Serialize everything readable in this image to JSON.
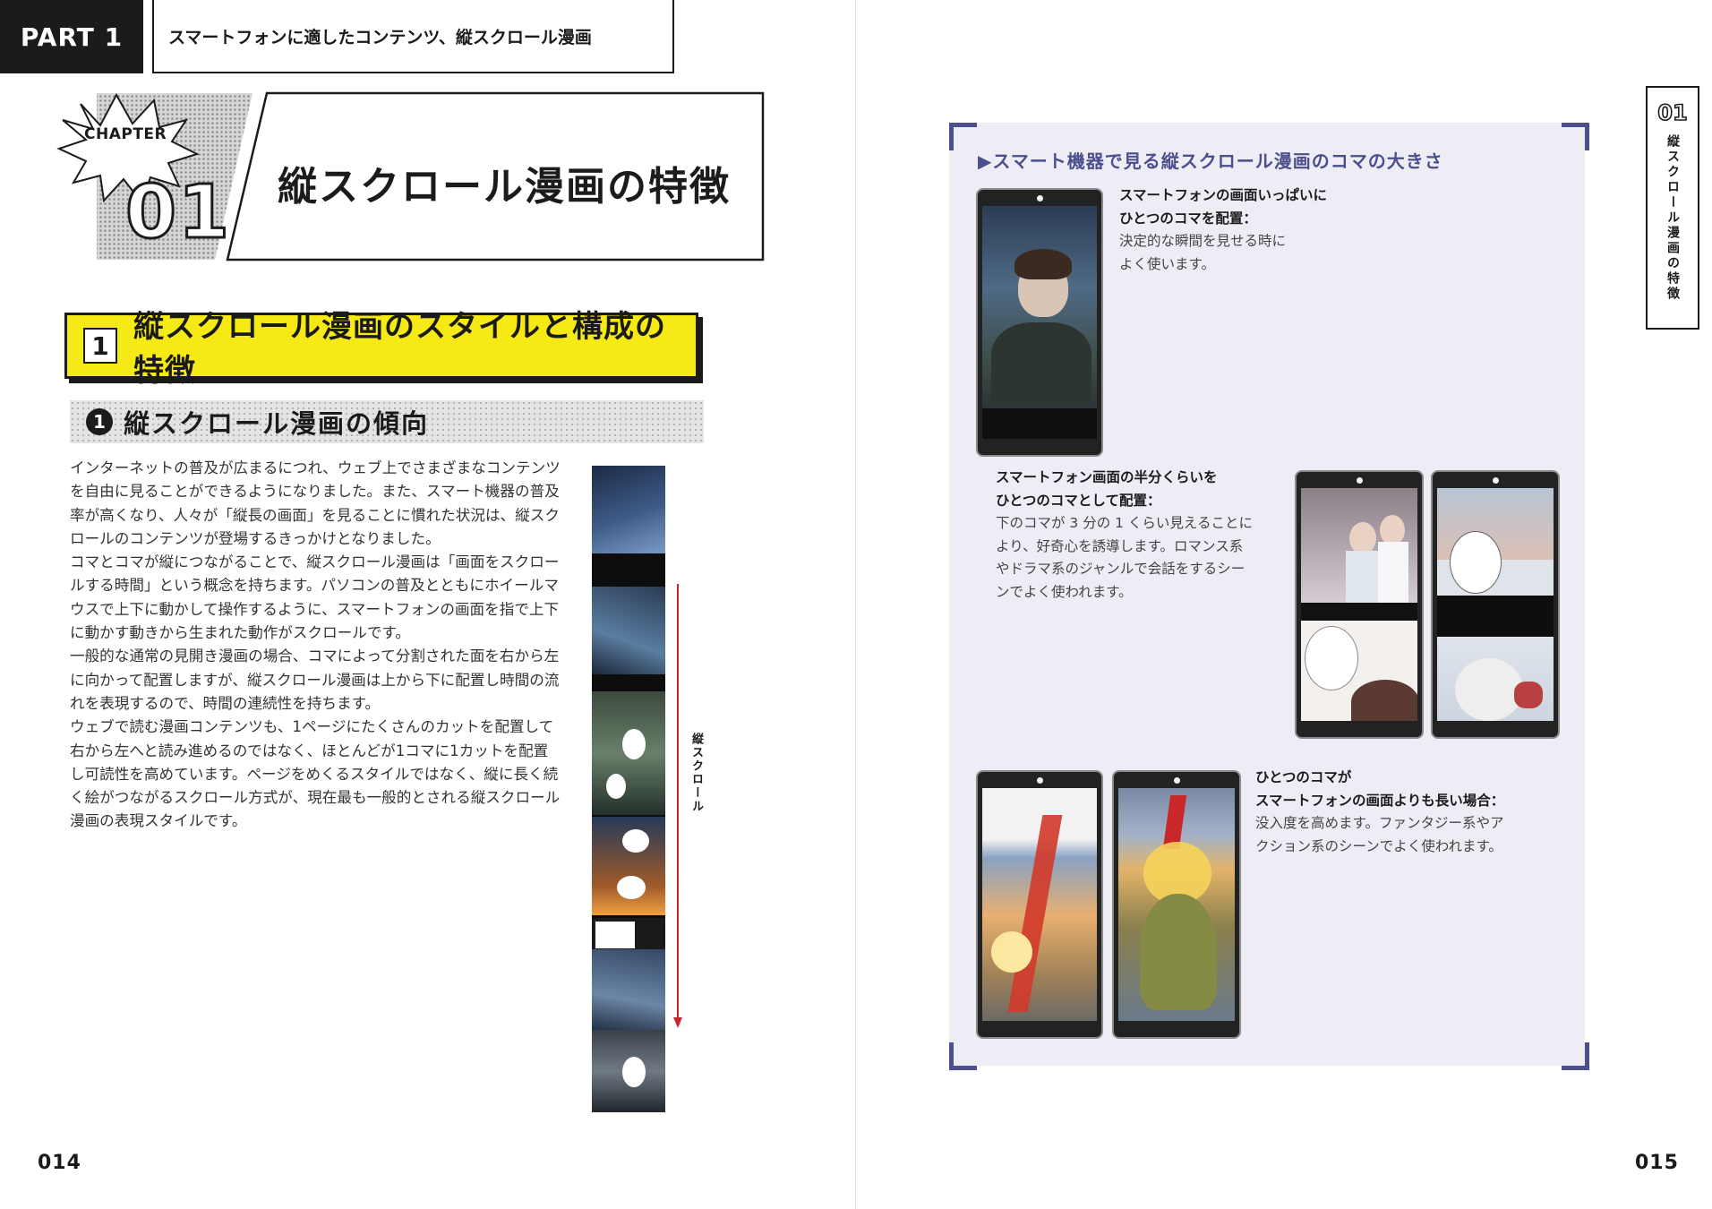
{
  "header": {
    "part_label": "PART 1",
    "part_title": "スマートフォンに適したコンテンツ、縦スクロール漫画"
  },
  "chapter": {
    "label": "CHAPTER",
    "number": "01",
    "title": "縦スクロール漫画の特徴"
  },
  "section": {
    "number": "1",
    "title": "縦スクロール漫画のスタイルと構成の特徴"
  },
  "subsection": {
    "number": "1",
    "title": "縦スクロール漫画の傾向"
  },
  "body": {
    "lines": [
      "インターネットの普及が広まるにつれ、ウェブ上でさまざまなコンテンツ",
      "を自由に見ることができるようになりました。また、スマート機器の普及",
      "率が高くなり、人々が「縦長の画面」を見ることに慣れた状況は、縦スク",
      "ロールのコンテンツが登場するきっかけとなりました。",
      "コマとコマが縦につながることで、縦スクロール漫画は「画面をスクロー",
      "ルする時間」という概念を持ちます。パソコンの普及とともにホイールマ",
      "ウスで上下に動かして操作するように、スマートフォンの画面を指で上下",
      "に動かす動きから生まれた動作がスクロールです。",
      "一般的な通常の見開き漫画の場合、コマによって分割された面を右から左",
      "に向かって配置しますが、縦スクロール漫画は上から下に配置し時間の流",
      "れを表現するので、時間の連続性を持ちます。",
      "ウェブで読む漫画コンテンツも、1ページにたくさんのカットを配置して",
      "右から左へと読み進めるのではなく、ほとんどが1コマに1カットを配置",
      "し可読性を高めています。ページをめくるスタイルではなく、縦に長く続",
      "く絵がつながるスクロール方式が、現在最も一般的とされる縦スクロール",
      "漫画の表現スタイルです。"
    ]
  },
  "strip": {
    "scroll_label": "縦スクロール",
    "arrow_color": "#c8282e"
  },
  "page_numbers": {
    "left": "014",
    "right": "015"
  },
  "side_tab": {
    "number": "01",
    "title": "縦スクロール漫画の特徴"
  },
  "figure": {
    "title": "▶スマート機器で見る縦スクロール漫画のコマの大きさ",
    "accent": "#4b4f8c",
    "captions": [
      {
        "bold": [
          "スマートフォンの画面いっぱいに",
          "ひとつのコマを配置："
        ],
        "text": [
          "決定的な瞬間を見せる時に",
          "よく使います。"
        ]
      },
      {
        "bold": [
          "スマートフォン画面の半分くらいを",
          "ひとつのコマとして配置："
        ],
        "text": [
          "下のコマが 3 分の 1 くらい見えることに",
          "より、好奇心を誘導します。ロマンス系",
          "やドラマ系のジャンルで会話をするシー",
          "ンでよく使われます。"
        ]
      },
      {
        "bold": [
          "ひとつのコマが",
          "スマートフォンの画面よりも長い場合："
        ],
        "text": [
          "没入度を高めます。ファンタジー系やア",
          "クション系のシーンでよく使われます。"
        ]
      }
    ]
  }
}
